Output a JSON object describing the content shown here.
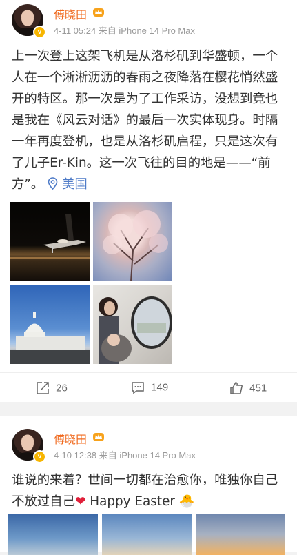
{
  "post1": {
    "author": "傅晓田",
    "meta": "4-11 05:24 来自 iPhone 14 Pro Max",
    "text": "上一次登上这架飞机是从洛杉矶到华盛顿，一个人在一个淅淅沥沥的春雨之夜降落在樱花悄然盛开的特区。那一次是为了工作采访，没想到竟也是我在《风云对话》的最后一次实体现身。时隔一年再度登机，也是从洛杉矶启程，只是这次有了儿子Er-Kin。这一次飞往的目的地是——“前方”。",
    "location": "美国",
    "photos": [
      "airplane-night-photo",
      "cherry-blossom-photo",
      "capitol-building-photo",
      "mother-baby-plane-window-photo"
    ],
    "actions": {
      "repost": "26",
      "comment": "149",
      "like": "451"
    }
  },
  "post2": {
    "author": "傅晓田",
    "meta": "4-10 12:38 来自 iPhone 14 Pro Max",
    "text_before": "谁说的来着？世间一切都在治愈你，唯独你自己不放过自己",
    "text_after": " Happy Easter",
    "emoji_heart": "❤",
    "emoji_chick": "🐣"
  },
  "colors": {
    "author": "#f06a1e",
    "location": "#4e7bc8",
    "verified": "#f7b500"
  }
}
